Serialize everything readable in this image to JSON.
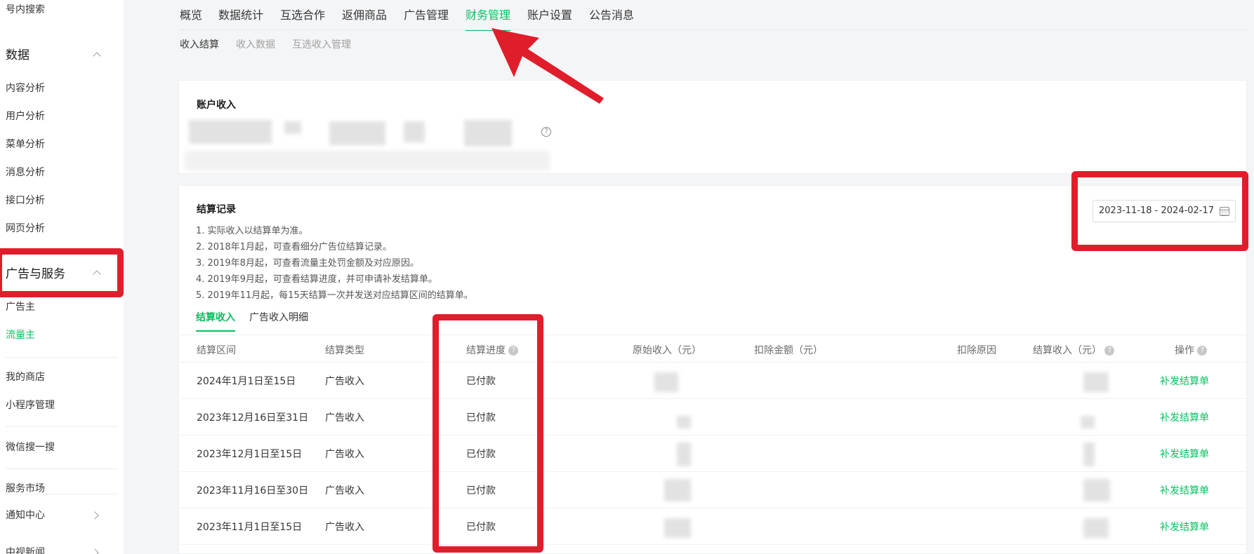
{
  "sidebar": {
    "top_item": "号内搜索",
    "data_group": "数据",
    "data_items": [
      "内容分析",
      "用户分析",
      "菜单分析",
      "消息分析",
      "接口分析",
      "网页分析"
    ],
    "ads_group": "广告与服务",
    "ads_items": [
      "广告主",
      "流量主"
    ],
    "other_items": [
      "我的商店",
      "小程序管理",
      "微信搜一搜",
      "服务市场"
    ],
    "bottom_items": [
      "通知中心",
      "中视新闻"
    ]
  },
  "topnav": {
    "tabs": [
      "概览",
      "数据统计",
      "互选合作",
      "返佣商品",
      "广告管理",
      "财务管理",
      "账户设置",
      "公告消息"
    ],
    "active": "财务管理"
  },
  "subnav": [
    "收入结算",
    "收入数据",
    "互选收入管理"
  ],
  "account": {
    "title": "账户收入"
  },
  "records": {
    "title": "结算记录",
    "notes": [
      "1. 实际收入以结算单为准。",
      "2. 2018年1月起，可查看细分广告位结算记录。",
      "3. 2019年8月起，可查看流量主处罚金额及对应原因。",
      "4. 2019年9月起，可查看结算进度，并可申请补发结算单。",
      "5. 2019年11月起，每15天结算一次并发送对应结算区间的结算单。"
    ],
    "date_range": "2023-11-18 - 2024-02-17",
    "tabs": [
      "结算收入",
      "广告收入明细"
    ]
  },
  "table": {
    "headers": [
      "结算区间",
      "结算类型",
      "结算进度",
      "原始收入（元）",
      "扣除金额（元）",
      "扣除原因",
      "结算收入（元）",
      "操作"
    ],
    "rows": [
      {
        "period": "2024年1月1日至15日",
        "type": "广告收入",
        "status": "已付款",
        "action": "补发结算单"
      },
      {
        "period": "2023年12月16日至31日",
        "type": "广告收入",
        "status": "已付款",
        "action": "补发结算单"
      },
      {
        "period": "2023年12月1日至15日",
        "type": "广告收入",
        "status": "已付款",
        "action": "补发结算单"
      },
      {
        "period": "2023年11月16日至30日",
        "type": "广告收入",
        "status": "已付款",
        "action": "补发结算单"
      },
      {
        "period": "2023年11月1日至15日",
        "type": "广告收入",
        "status": "已付款",
        "action": "补发结算单"
      }
    ]
  },
  "colors": {
    "accent": "#07c160",
    "highlight": "#e01e2b"
  }
}
